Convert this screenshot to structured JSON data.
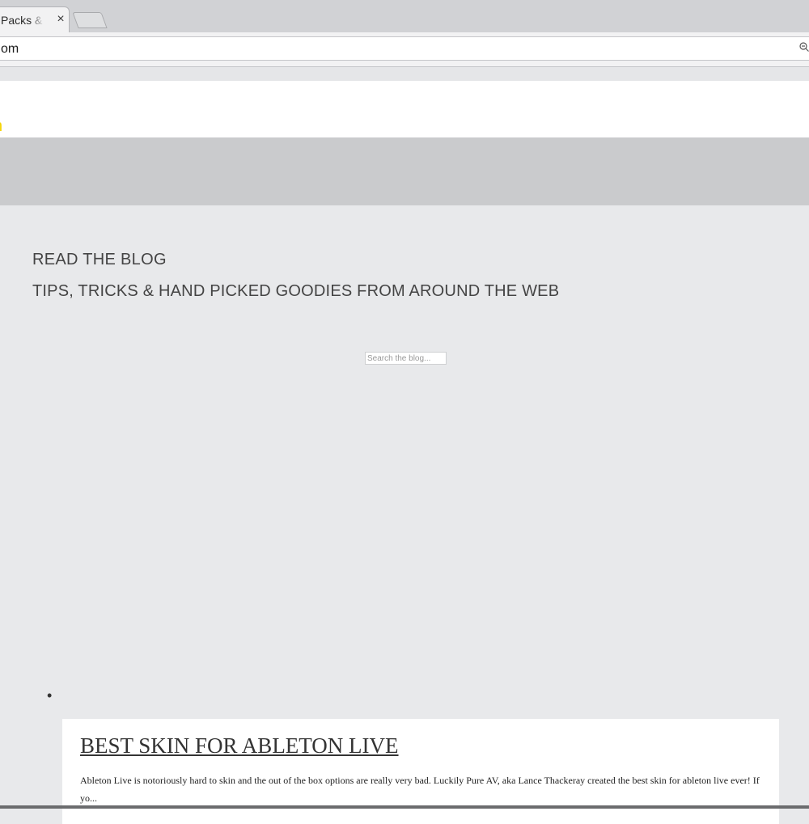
{
  "browser": {
    "tab_title": "Packs & P",
    "tab_close": "×",
    "address": "om"
  },
  "header": {
    "logo_fragment": "n"
  },
  "blog": {
    "heading": "READ THE BLOG",
    "subheading": "TIPS, TRICKS & HAND PICKED GOODIES FROM AROUND THE WEB",
    "search_placeholder": "Search the blog..."
  },
  "posts": [
    {
      "bullet": "•",
      "title": "BEST SKIN FOR ABLETON LIVE",
      "excerpt": "Ableton Live is notoriously hard to skin and the out of the box options are really very bad. Luckily Pure AV, aka Lance Thackeray created the best skin for ableton live ever! If yo..."
    }
  ],
  "colors": {
    "logo_accent": "#f5d400",
    "page_background": "#e8e9eb",
    "nav_band": "#cacbcd"
  }
}
